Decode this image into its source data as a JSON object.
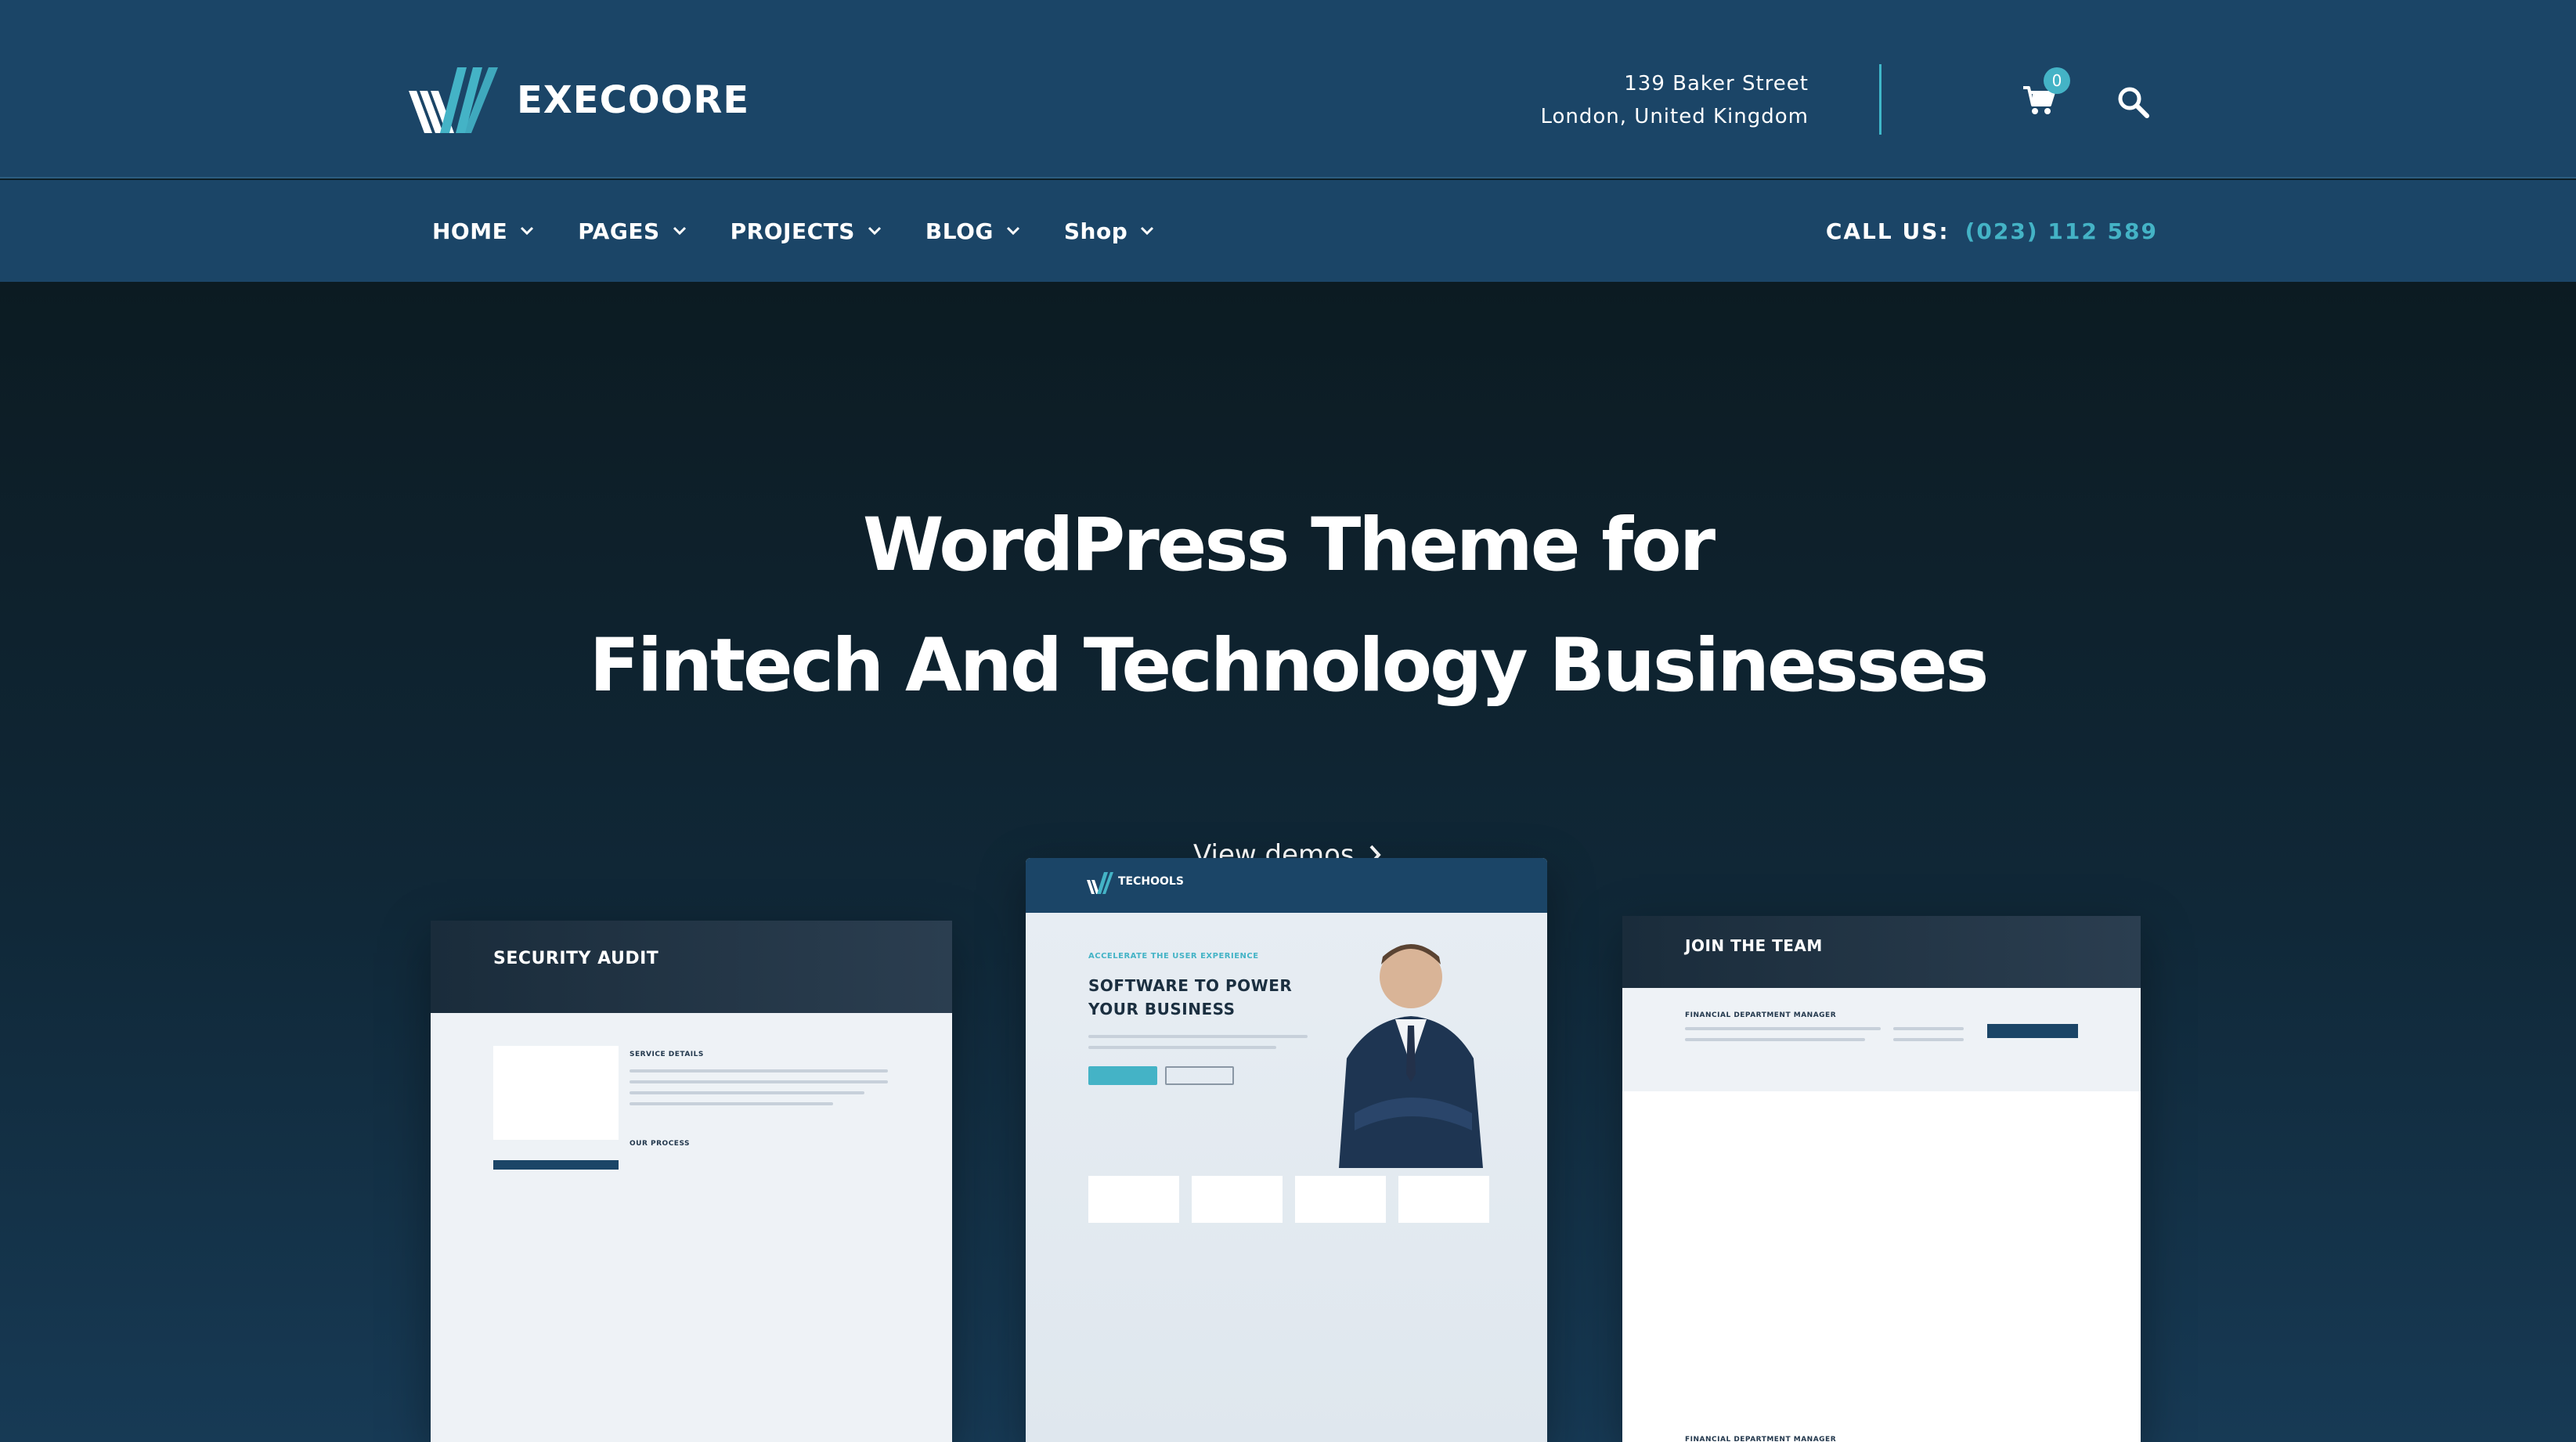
{
  "brand": {
    "name": "EXECOORE"
  },
  "address": {
    "line1": "139 Baker Street",
    "line2": "London, United Kingdom"
  },
  "cart": {
    "count": "0"
  },
  "nav": {
    "items": [
      {
        "label": "HOME"
      },
      {
        "label": "PAGES"
      },
      {
        "label": "PROJECTS"
      },
      {
        "label": "BLOG"
      },
      {
        "label": "Shop"
      }
    ],
    "call_label": "CALL US:",
    "call_number": "(023) 112 589"
  },
  "hero": {
    "line1": "WordPress Theme for",
    "line2": "Fintech And Technology Businesses",
    "cta": "View demos"
  },
  "previews": {
    "left": {
      "title": "SECURITY AUDIT",
      "section1": "SERVICE DETAILS",
      "section2": "OUR PROCESS"
    },
    "center": {
      "brand": "TECHOOLS",
      "kicker": "ACCELERATE THE USER EXPERIENCE",
      "headline_1": "SOFTWARE TO POWER",
      "headline_2": "YOUR BUSINESS"
    },
    "right": {
      "title": "JOIN THE TEAM",
      "section1": "FINANCIAL DEPARTMENT MANAGER",
      "section2": "FINANCIAL DEPARTMENT MANAGER"
    }
  },
  "colors": {
    "header": "#1b4567",
    "accent": "#44b3c6",
    "hero_dark": "#0c1b22"
  }
}
